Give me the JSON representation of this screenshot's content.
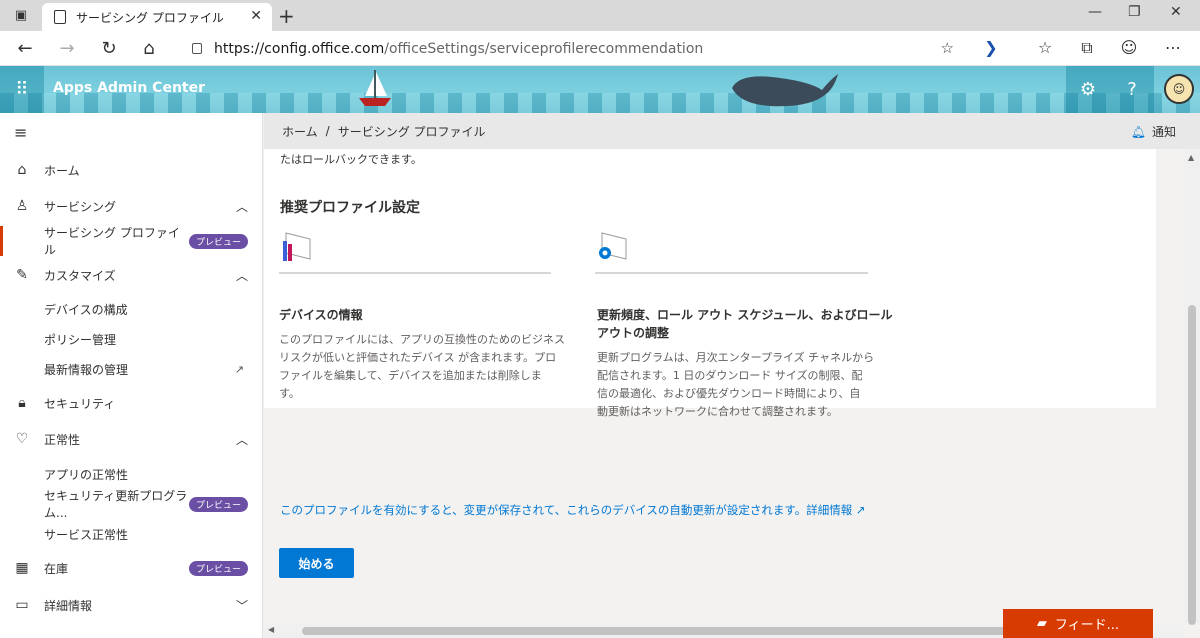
{
  "browser": {
    "tab_title": "サービシング プロファイル",
    "url_host": "https://config.office.com",
    "url_path": "/officeSettings/serviceprofilerecommendation"
  },
  "app": {
    "title": "Apps Admin Center"
  },
  "nav": {
    "home": "ホーム",
    "servicing": "サービシング",
    "servicing_profile": "サービシング プロファイル",
    "preview_badge": "プレビュー",
    "customize": "カスタマイズ",
    "device_config": "デバイスの構成",
    "policy_mgmt": "ポリシー管理",
    "whats_new": "最新情報の管理",
    "security": "セキュリティ",
    "health": "正常性",
    "app_health": "アプリの正常性",
    "security_update": "セキュリティ更新プログラム...",
    "service_health": "サービス正常性",
    "inventory": "在庫",
    "learn_more": "詳細情報"
  },
  "breadcrumb": {
    "home": "ホーム",
    "separator": "/",
    "current": "サービシング プロファイル",
    "notifications": "通知"
  },
  "content": {
    "top_text": "たはロールバックできます。",
    "section_title": "推奨プロファイル設定",
    "feature1_title": "デバイスの情報",
    "feature1_desc_line1": "このプロファイルには、アプリの互換性のためのビジネス",
    "feature1_desc_line2": "リスクが低いと評価されたデバイス が含まれます。プロ",
    "feature1_desc_line3": "ファイルを編集して、デバイスを追加または削除しま",
    "feature1_desc_line4": "す。",
    "feature2_title_line1": "更新頻度、ロール アウト スケジュール、およびロール",
    "feature2_title_line2": "アウトの調整",
    "feature2_desc_line1": "更新プログラムは、月次エンタープライズ チャネルから",
    "feature2_desc_line2": "配信されます。1 日のダウンロード サイズの制限、配",
    "feature2_desc_line3": "信の最適化、および優先ダウンロード時間により、自",
    "feature2_desc_line4": "動更新はネットワークに合わせて調整されます。",
    "info_text": "このプロファイルを有効にすると、変更が保存されて、これらのデバイスの自動更新が設定されます。詳細情報",
    "start_button": "始める"
  },
  "feedback": {
    "label": "フィード..."
  },
  "colors": {
    "accent": "#0078d4",
    "selected_indicator": "#d83b01",
    "badge": "#6b4fa5",
    "feedback": "#d83b01"
  }
}
